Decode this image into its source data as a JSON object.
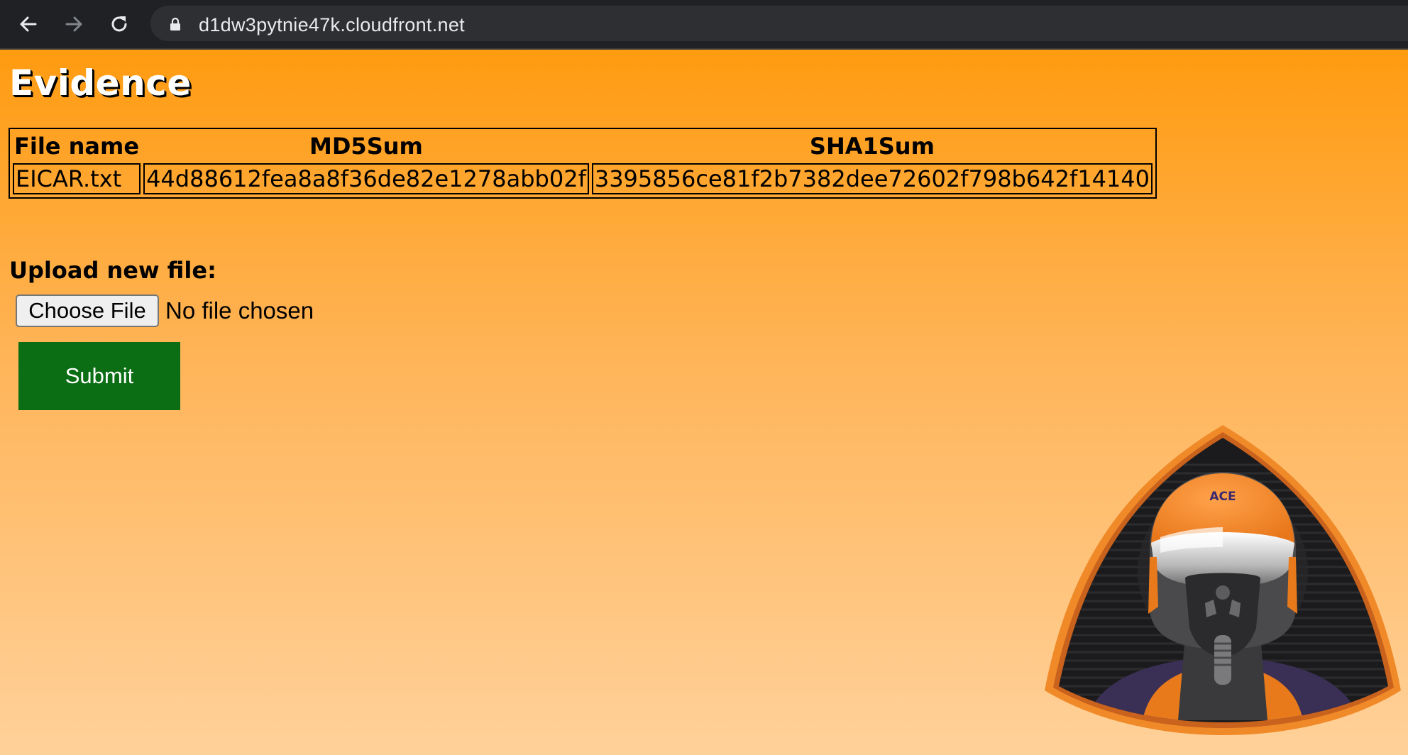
{
  "browser": {
    "url": "d1dw3pytnie47k.cloudfront.net"
  },
  "page": {
    "title": "Evidence",
    "table": {
      "headers": [
        "File name",
        "MD5Sum",
        "SHA1Sum"
      ],
      "rows": [
        [
          "EICAR.txt",
          "44d88612fea8a8f36de82e1278abb02f",
          "3395856ce81f2b7382dee72602f798b642f14140"
        ]
      ]
    },
    "upload": {
      "label": "Upload new file:",
      "choose_button": "Choose File",
      "status": "No file chosen",
      "submit_label": "Submit"
    },
    "mascot": {
      "helmet_text": "ACE"
    }
  },
  "colors": {
    "background_top": "#ff9b10",
    "background_bottom": "#ffd19a",
    "submit": "#0b6e14",
    "chrome": "#202124"
  }
}
